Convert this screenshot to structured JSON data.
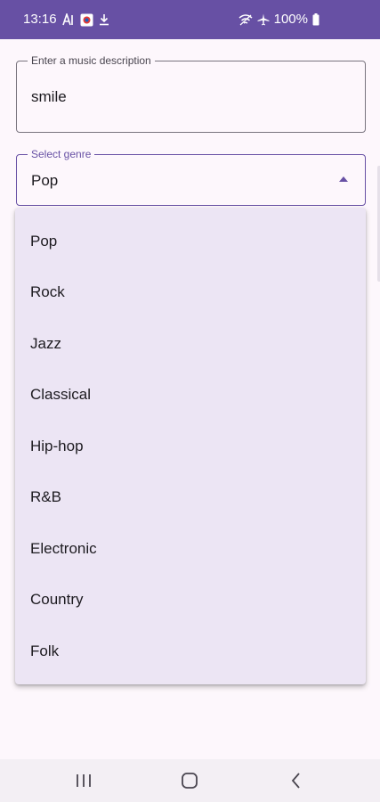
{
  "status_bar": {
    "time": "13:16",
    "battery": "100%",
    "icons": [
      "a-text-icon",
      "recorder-icon",
      "download-icon",
      "wifi-icon",
      "airplane-icon",
      "battery-icon"
    ]
  },
  "description_field": {
    "label": "Enter a music description",
    "value": "smile"
  },
  "genre_field": {
    "label": "Select genre",
    "value": "Pop"
  },
  "genre_menu": {
    "items": [
      "Pop",
      "Rock",
      "Jazz",
      "Classical",
      "Hip-hop",
      "R&B",
      "Electronic",
      "Country",
      "Folk"
    ]
  },
  "nav_bar": {
    "buttons": [
      "recent-apps-icon",
      "home-icon",
      "back-icon"
    ]
  },
  "colors": {
    "primary": "#6750a4",
    "background": "#fdf7fc",
    "menu_background": "#ece5f4"
  }
}
